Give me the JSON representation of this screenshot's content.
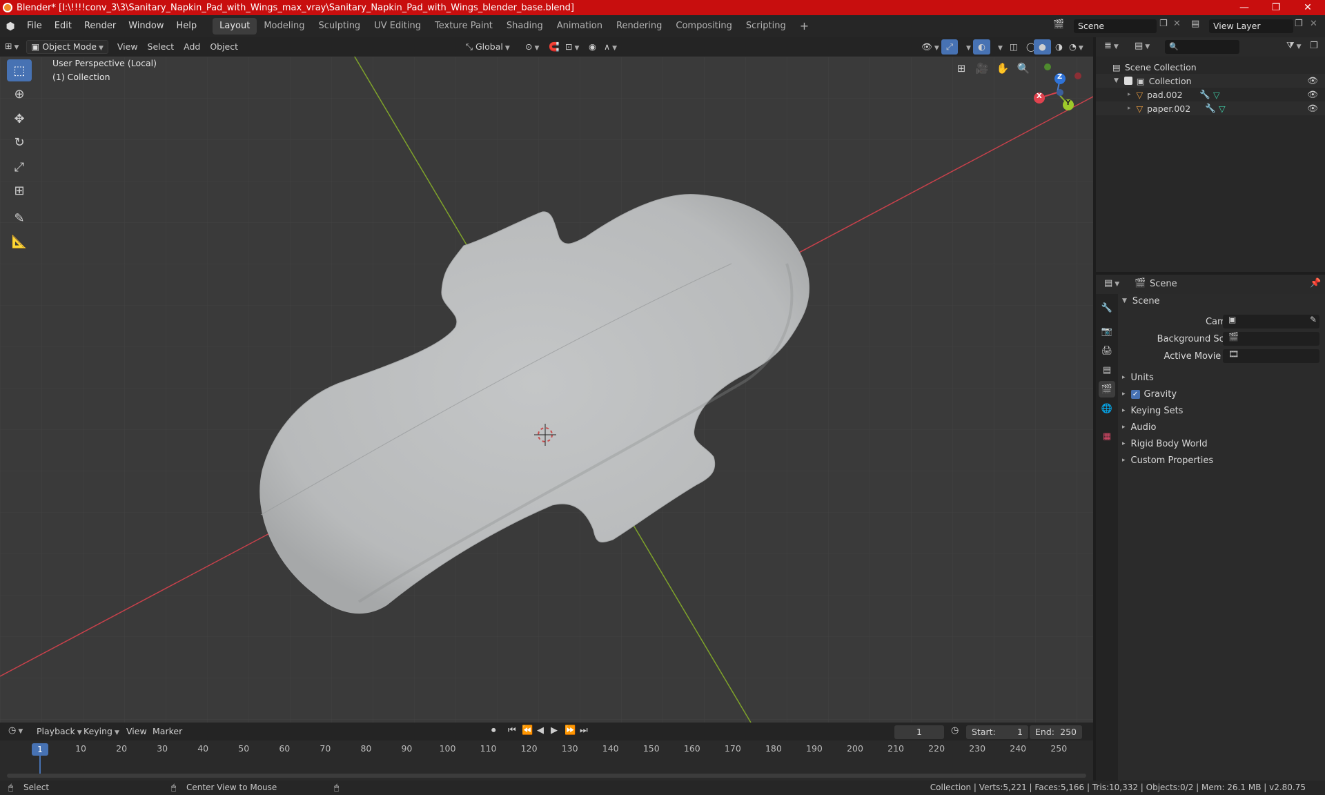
{
  "window": {
    "title": "Blender* [I:\\!!!!conv_3\\3\\Sanitary_Napkin_Pad_with_Wings_max_vray\\Sanitary_Napkin_Pad_with_Wings_blender_base.blend]",
    "minimize": "—",
    "maximize": "❐",
    "close": "✕"
  },
  "menus": [
    "File",
    "Edit",
    "Render",
    "Window",
    "Help"
  ],
  "workspaces": [
    "Layout",
    "Modeling",
    "Sculpting",
    "UV Editing",
    "Texture Paint",
    "Shading",
    "Animation",
    "Rendering",
    "Compositing",
    "Scripting"
  ],
  "workspace_active": "Layout",
  "add_workspace": "+",
  "scene_selector": {
    "value": "Scene"
  },
  "view_layer": {
    "value": "View Layer"
  },
  "viewport_header": {
    "mode": "Object Mode",
    "menus": [
      "View",
      "Select",
      "Add",
      "Object"
    ],
    "orientation": "Global"
  },
  "viewport": {
    "perspective_label": "User Perspective (Local)",
    "collection_label": "(1) Collection",
    "gizmo": {
      "x": "X",
      "y": "Y",
      "z": "Z"
    }
  },
  "outliner": {
    "root": "Scene Collection",
    "collection": "Collection",
    "objects": [
      "pad.002",
      "paper.002"
    ]
  },
  "properties": {
    "header": "Scene",
    "panel": "Scene",
    "fields": [
      "Camera",
      "Background Scene",
      "Active Movie Clip"
    ],
    "sections": [
      "Units",
      "Gravity",
      "Keying Sets",
      "Audio",
      "Rigid Body World",
      "Custom Properties"
    ],
    "gravity_checked": true
  },
  "timeline": {
    "menus": [
      "Playback",
      "Keying",
      "View",
      "Marker"
    ],
    "current_frame": "1",
    "start_label": "Start:",
    "start": "1",
    "end_label": "End:",
    "end": "250",
    "ticks": [
      "10",
      "20",
      "30",
      "40",
      "50",
      "60",
      "70",
      "80",
      "90",
      "100",
      "110",
      "120",
      "130",
      "140",
      "150",
      "160",
      "170",
      "180",
      "190",
      "200",
      "210",
      "220",
      "230",
      "240",
      "250"
    ],
    "playhead": "1"
  },
  "statusbar": {
    "select": "Select",
    "center": "Center View to Mouse",
    "stats": "Collection | Verts:5,221 | Faces:5,166 | Tris:10,332 | Objects:0/2 | Mem: 26.1 MB | v2.80.75"
  },
  "colors": {
    "title_bar": "#c80e0e",
    "viewport_bg": "#3a3a3a",
    "x_axis": "#c8414b",
    "y_axis": "#7fa32a",
    "accent": "#4772b3"
  }
}
